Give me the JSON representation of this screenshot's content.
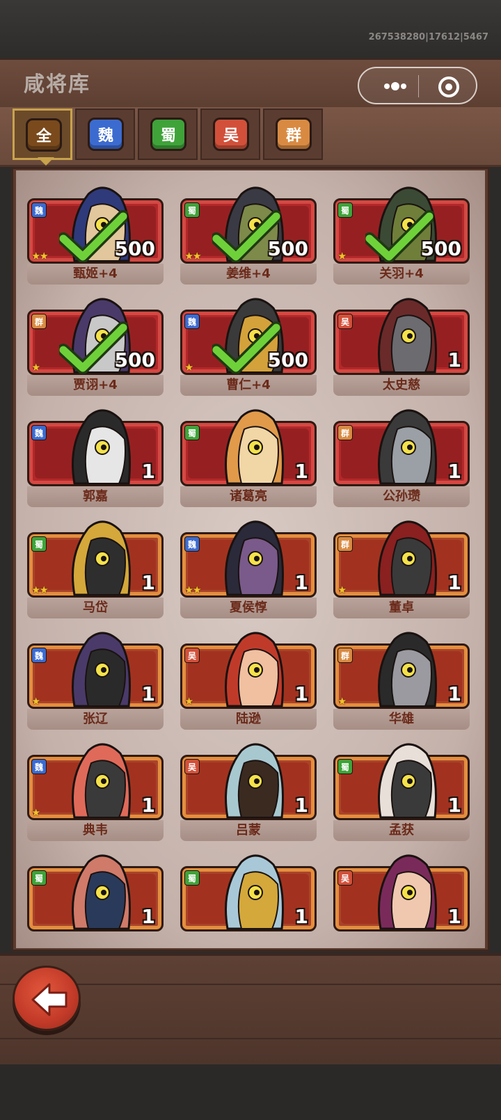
{
  "build_id": "267538280|17612|5467",
  "title": "咸将库",
  "capsule": {
    "more_icon": "more-dots-icon",
    "target_icon": "target-circle-icon"
  },
  "tabs": [
    {
      "label": "全",
      "color": "#7a4a1c",
      "active": true
    },
    {
      "label": "魏",
      "color": "#3c6bd0",
      "active": false
    },
    {
      "label": "蜀",
      "color": "#3fa33a",
      "active": false
    },
    {
      "label": "吴",
      "color": "#d2503a",
      "active": false
    },
    {
      "label": "群",
      "color": "#d98a42",
      "active": false
    }
  ],
  "heroes": [
    {
      "name": "甄姬+4",
      "faction": "魏",
      "stars": "★★",
      "count": "500",
      "owned": true,
      "frame": "red"
    },
    {
      "name": "姜维+4",
      "faction": "蜀",
      "stars": "★★",
      "count": "500",
      "owned": true,
      "frame": "red"
    },
    {
      "name": "关羽+4",
      "faction": "蜀",
      "stars": "★",
      "count": "500",
      "owned": true,
      "frame": "red"
    },
    {
      "name": "贾诩+4",
      "faction": "群",
      "stars": "★",
      "count": "500",
      "owned": true,
      "frame": "red"
    },
    {
      "name": "曹仁+4",
      "faction": "魏",
      "stars": "★",
      "count": "500",
      "owned": true,
      "frame": "red"
    },
    {
      "name": "太史慈",
      "faction": "吴",
      "stars": "",
      "count": "1",
      "owned": false,
      "frame": "red"
    },
    {
      "name": "郭嘉",
      "faction": "魏",
      "stars": "",
      "count": "1",
      "owned": false,
      "frame": "red"
    },
    {
      "name": "诸葛亮",
      "faction": "蜀",
      "stars": "",
      "count": "1",
      "owned": false,
      "frame": "red"
    },
    {
      "name": "公孙瓒",
      "faction": "群",
      "stars": "",
      "count": "1",
      "owned": false,
      "frame": "red"
    },
    {
      "name": "马岱",
      "faction": "蜀",
      "stars": "★★",
      "count": "1",
      "owned": false,
      "frame": "orange"
    },
    {
      "name": "夏侯惇",
      "faction": "魏",
      "stars": "★★",
      "count": "1",
      "owned": false,
      "frame": "orange"
    },
    {
      "name": "董卓",
      "faction": "群",
      "stars": "★",
      "count": "1",
      "owned": false,
      "frame": "orange"
    },
    {
      "name": "张辽",
      "faction": "魏",
      "stars": "★",
      "count": "1",
      "owned": false,
      "frame": "orange"
    },
    {
      "name": "陆逊",
      "faction": "吴",
      "stars": "★",
      "count": "1",
      "owned": false,
      "frame": "orange"
    },
    {
      "name": "华雄",
      "faction": "群",
      "stars": "★",
      "count": "1",
      "owned": false,
      "frame": "orange"
    },
    {
      "name": "典韦",
      "faction": "魏",
      "stars": "★",
      "count": "1",
      "owned": false,
      "frame": "orange"
    },
    {
      "name": "吕蒙",
      "faction": "吴",
      "stars": "",
      "count": "1",
      "owned": false,
      "frame": "orange"
    },
    {
      "name": "孟获",
      "faction": "蜀",
      "stars": "",
      "count": "1",
      "owned": false,
      "frame": "orange"
    },
    {
      "name": "",
      "faction": "蜀",
      "stars": "",
      "count": "1",
      "owned": false,
      "frame": "orange"
    },
    {
      "name": "",
      "faction": "蜀",
      "stars": "",
      "count": "1",
      "owned": false,
      "frame": "orange"
    },
    {
      "name": "",
      "faction": "吴",
      "stars": "",
      "count": "1",
      "owned": false,
      "frame": "orange"
    }
  ],
  "faction_colors": {
    "魏": "#3c6bd0",
    "蜀": "#3fa33a",
    "吴": "#d2503a",
    "群": "#d98a42"
  },
  "back_button": {
    "icon": "back-arrow-icon"
  }
}
